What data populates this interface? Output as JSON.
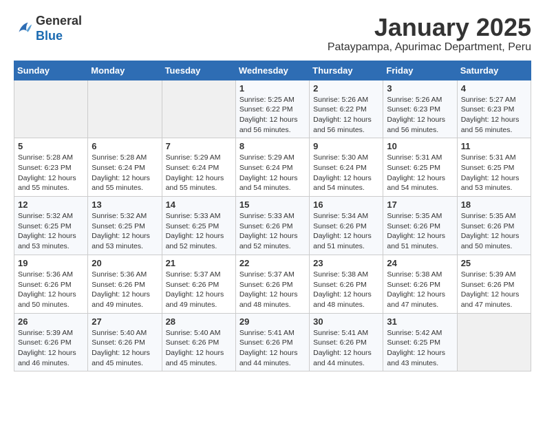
{
  "logo": {
    "general": "General",
    "blue": "Blue"
  },
  "header": {
    "title": "January 2025",
    "subtitle": "Pataypampa, Apurimac Department, Peru"
  },
  "weekdays": [
    "Sunday",
    "Monday",
    "Tuesday",
    "Wednesday",
    "Thursday",
    "Friday",
    "Saturday"
  ],
  "weeks": [
    [
      {
        "day": "",
        "info": ""
      },
      {
        "day": "",
        "info": ""
      },
      {
        "day": "",
        "info": ""
      },
      {
        "day": "1",
        "info": "Sunrise: 5:25 AM\nSunset: 6:22 PM\nDaylight: 12 hours\nand 56 minutes."
      },
      {
        "day": "2",
        "info": "Sunrise: 5:26 AM\nSunset: 6:22 PM\nDaylight: 12 hours\nand 56 minutes."
      },
      {
        "day": "3",
        "info": "Sunrise: 5:26 AM\nSunset: 6:23 PM\nDaylight: 12 hours\nand 56 minutes."
      },
      {
        "day": "4",
        "info": "Sunrise: 5:27 AM\nSunset: 6:23 PM\nDaylight: 12 hours\nand 56 minutes."
      }
    ],
    [
      {
        "day": "5",
        "info": "Sunrise: 5:28 AM\nSunset: 6:23 PM\nDaylight: 12 hours\nand 55 minutes."
      },
      {
        "day": "6",
        "info": "Sunrise: 5:28 AM\nSunset: 6:24 PM\nDaylight: 12 hours\nand 55 minutes."
      },
      {
        "day": "7",
        "info": "Sunrise: 5:29 AM\nSunset: 6:24 PM\nDaylight: 12 hours\nand 55 minutes."
      },
      {
        "day": "8",
        "info": "Sunrise: 5:29 AM\nSunset: 6:24 PM\nDaylight: 12 hours\nand 54 minutes."
      },
      {
        "day": "9",
        "info": "Sunrise: 5:30 AM\nSunset: 6:24 PM\nDaylight: 12 hours\nand 54 minutes."
      },
      {
        "day": "10",
        "info": "Sunrise: 5:31 AM\nSunset: 6:25 PM\nDaylight: 12 hours\nand 54 minutes."
      },
      {
        "day": "11",
        "info": "Sunrise: 5:31 AM\nSunset: 6:25 PM\nDaylight: 12 hours\nand 53 minutes."
      }
    ],
    [
      {
        "day": "12",
        "info": "Sunrise: 5:32 AM\nSunset: 6:25 PM\nDaylight: 12 hours\nand 53 minutes."
      },
      {
        "day": "13",
        "info": "Sunrise: 5:32 AM\nSunset: 6:25 PM\nDaylight: 12 hours\nand 53 minutes."
      },
      {
        "day": "14",
        "info": "Sunrise: 5:33 AM\nSunset: 6:25 PM\nDaylight: 12 hours\nand 52 minutes."
      },
      {
        "day": "15",
        "info": "Sunrise: 5:33 AM\nSunset: 6:26 PM\nDaylight: 12 hours\nand 52 minutes."
      },
      {
        "day": "16",
        "info": "Sunrise: 5:34 AM\nSunset: 6:26 PM\nDaylight: 12 hours\nand 51 minutes."
      },
      {
        "day": "17",
        "info": "Sunrise: 5:35 AM\nSunset: 6:26 PM\nDaylight: 12 hours\nand 51 minutes."
      },
      {
        "day": "18",
        "info": "Sunrise: 5:35 AM\nSunset: 6:26 PM\nDaylight: 12 hours\nand 50 minutes."
      }
    ],
    [
      {
        "day": "19",
        "info": "Sunrise: 5:36 AM\nSunset: 6:26 PM\nDaylight: 12 hours\nand 50 minutes."
      },
      {
        "day": "20",
        "info": "Sunrise: 5:36 AM\nSunset: 6:26 PM\nDaylight: 12 hours\nand 49 minutes."
      },
      {
        "day": "21",
        "info": "Sunrise: 5:37 AM\nSunset: 6:26 PM\nDaylight: 12 hours\nand 49 minutes."
      },
      {
        "day": "22",
        "info": "Sunrise: 5:37 AM\nSunset: 6:26 PM\nDaylight: 12 hours\nand 48 minutes."
      },
      {
        "day": "23",
        "info": "Sunrise: 5:38 AM\nSunset: 6:26 PM\nDaylight: 12 hours\nand 48 minutes."
      },
      {
        "day": "24",
        "info": "Sunrise: 5:38 AM\nSunset: 6:26 PM\nDaylight: 12 hours\nand 47 minutes."
      },
      {
        "day": "25",
        "info": "Sunrise: 5:39 AM\nSunset: 6:26 PM\nDaylight: 12 hours\nand 47 minutes."
      }
    ],
    [
      {
        "day": "26",
        "info": "Sunrise: 5:39 AM\nSunset: 6:26 PM\nDaylight: 12 hours\nand 46 minutes."
      },
      {
        "day": "27",
        "info": "Sunrise: 5:40 AM\nSunset: 6:26 PM\nDaylight: 12 hours\nand 45 minutes."
      },
      {
        "day": "28",
        "info": "Sunrise: 5:40 AM\nSunset: 6:26 PM\nDaylight: 12 hours\nand 45 minutes."
      },
      {
        "day": "29",
        "info": "Sunrise: 5:41 AM\nSunset: 6:26 PM\nDaylight: 12 hours\nand 44 minutes."
      },
      {
        "day": "30",
        "info": "Sunrise: 5:41 AM\nSunset: 6:26 PM\nDaylight: 12 hours\nand 44 minutes."
      },
      {
        "day": "31",
        "info": "Sunrise: 5:42 AM\nSunset: 6:25 PM\nDaylight: 12 hours\nand 43 minutes."
      },
      {
        "day": "",
        "info": ""
      }
    ]
  ]
}
